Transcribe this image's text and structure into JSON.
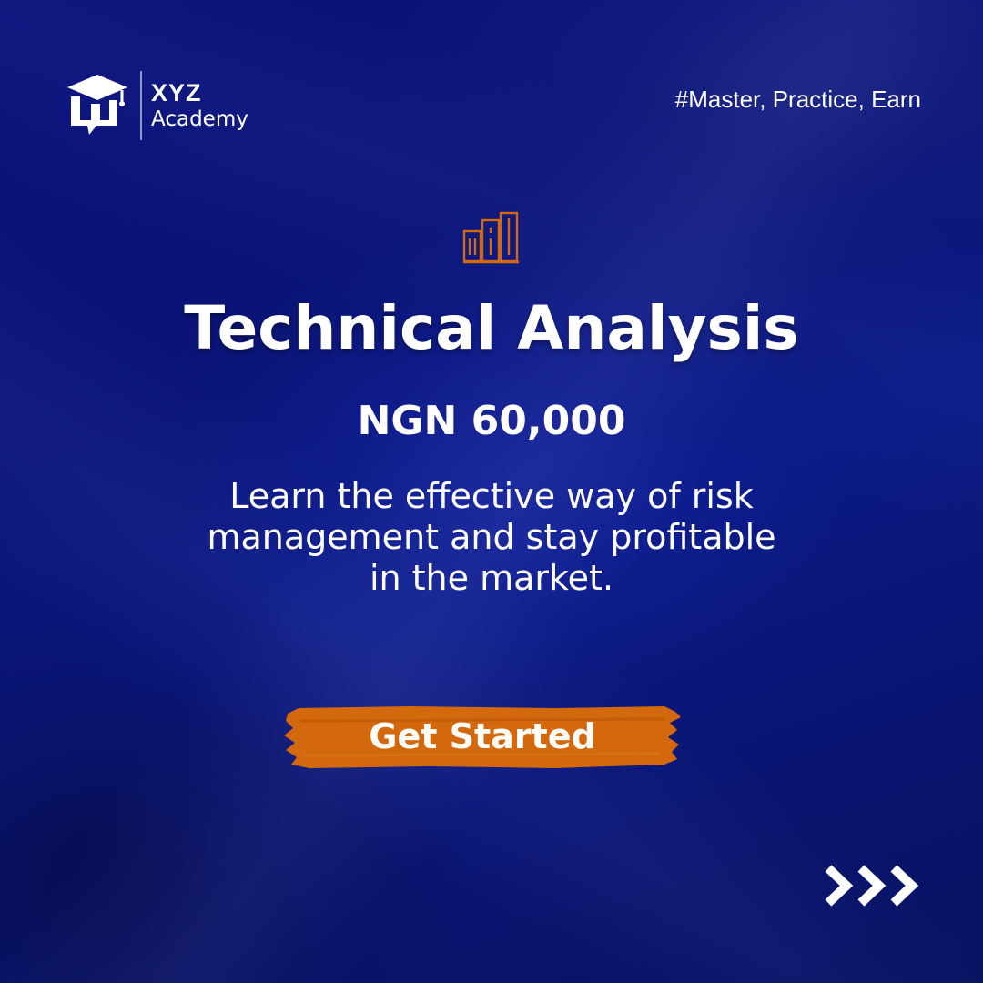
{
  "brand": {
    "name": "XYZ",
    "subtitle": "Academy",
    "logo_icon": "graduation-cap-icon"
  },
  "tagline": "#Master, Practice, Earn",
  "hero": {
    "icon": "bar-chart-icon",
    "title": "Technical Analysis",
    "price": "NGN 60,000",
    "description_lines": [
      "Learn the effective way of risk",
      "management and stay profitable",
      "in the market."
    ]
  },
  "cta": {
    "label": "Get Started"
  },
  "nav": {
    "next_icon": "triple-chevron-right-icon"
  },
  "colors": {
    "background": "#0b1580",
    "accent": "#d4680c",
    "text": "#ffffff"
  }
}
